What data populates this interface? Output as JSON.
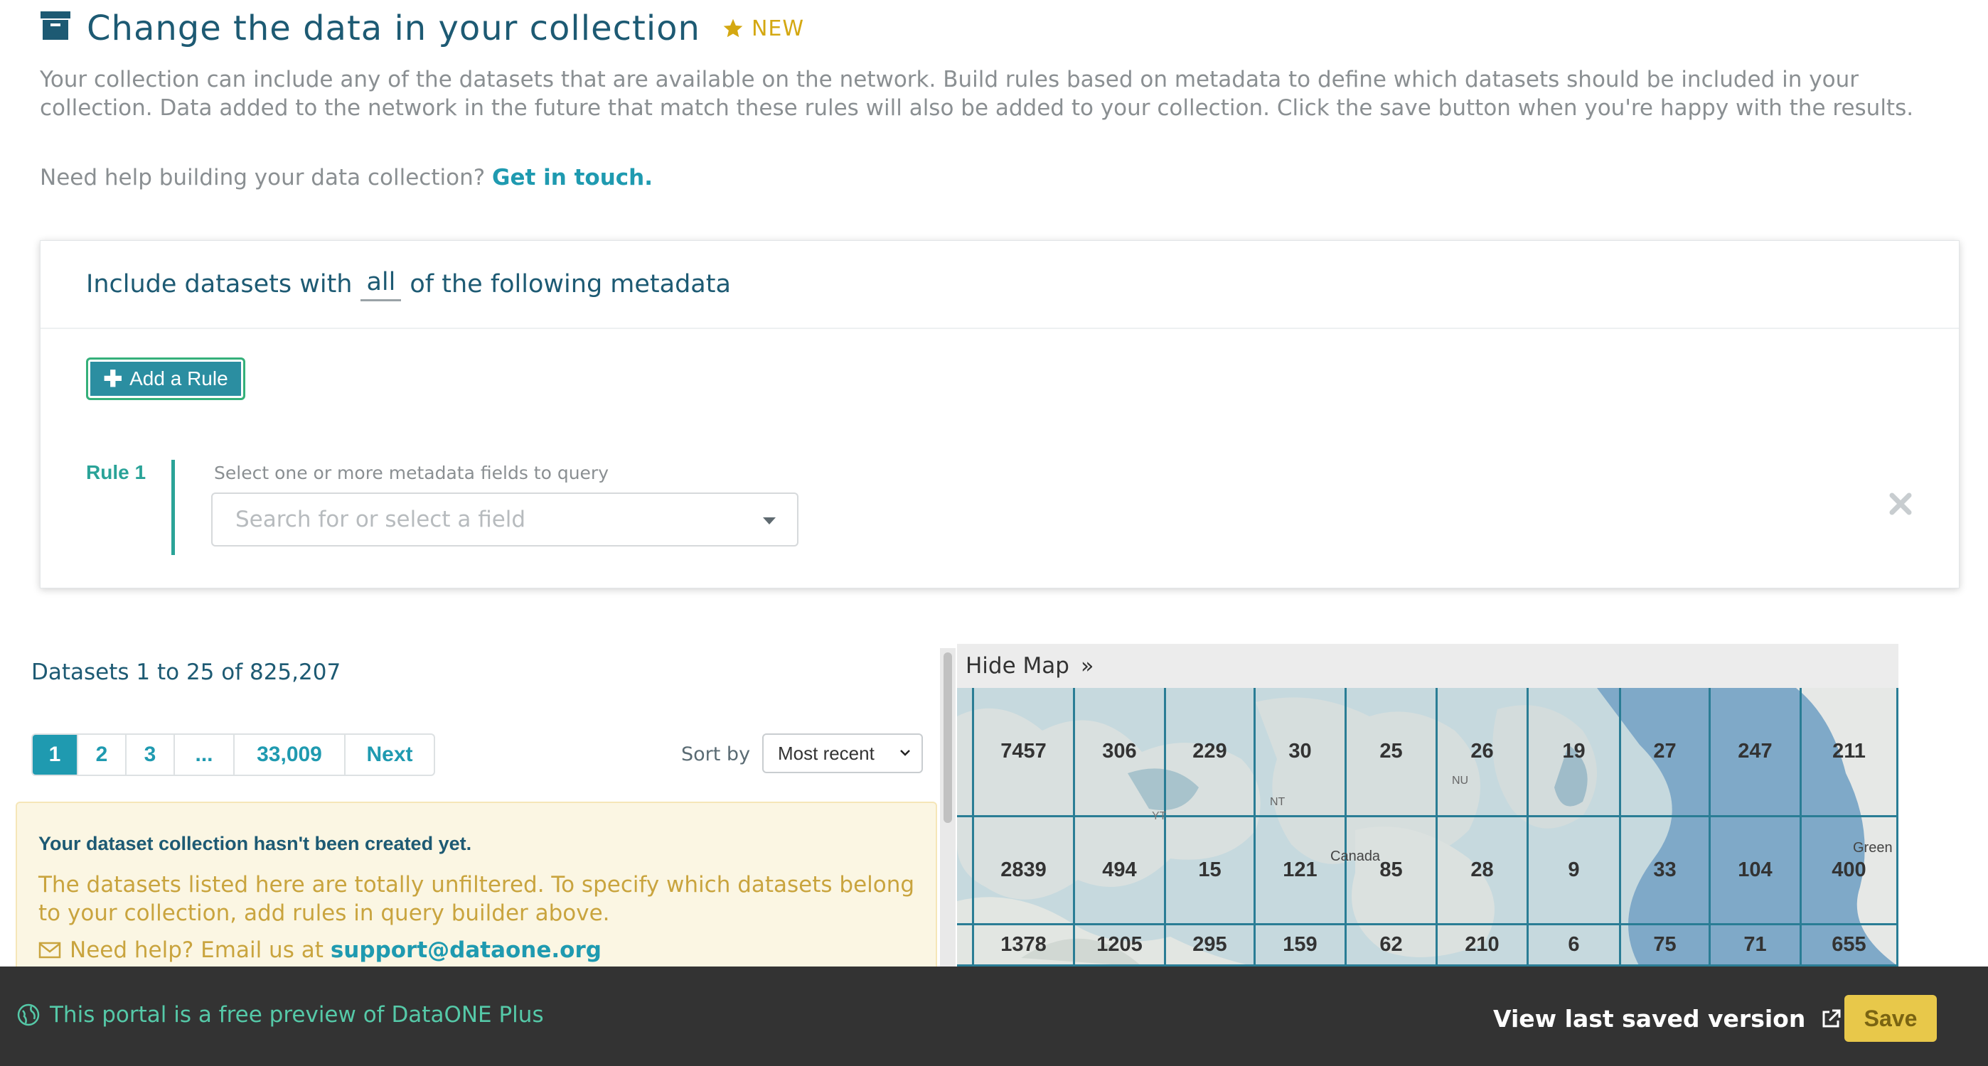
{
  "header": {
    "icon": "archive-box-icon",
    "title": "Change the data in your collection",
    "badge_icon": "star-icon",
    "badge_label": "NEW",
    "accent_color": "#1d5a73",
    "badge_color": "#d4a812"
  },
  "intro": {
    "text": "Your collection can include any of the datasets that are available on the network. Build rules based on metadata to define which datasets should be included in your collection. Data added to the network in the future that match these rules will also be added to your collection. Click the save button when you're happy with the results.",
    "help_prefix": "Need help building your data collection?",
    "help_link": "Get in touch."
  },
  "query_builder": {
    "header_prefix": "Include datasets with",
    "operator": "all",
    "header_suffix": "of the following metadata",
    "add_rule_label": "Add a Rule",
    "rule": {
      "label": "Rule 1",
      "hint": "Select one or more metadata fields to query",
      "placeholder": "Search for or select a field"
    }
  },
  "results": {
    "count_text": "Datasets 1 to 25 of 825,207",
    "pages": [
      "1",
      "2",
      "3",
      "...",
      "33,009",
      "Next"
    ],
    "active_page": "1",
    "sort_label": "Sort by",
    "sort_value": "Most recent"
  },
  "alert": {
    "title": "Your dataset collection hasn't been created yet.",
    "body": "The datasets listed here are totally unfiltered. To specify which datasets belong to your collection, add rules in query builder above.",
    "help_prefix": "Need help? Email us at",
    "help_email": "support@dataone.org"
  },
  "map": {
    "toggle_label": "Hide Map",
    "place_labels": [
      "Canada",
      "NU",
      "NT",
      "YT",
      "Green"
    ],
    "rows": [
      [
        "",
        "7457",
        "306",
        "229",
        "30",
        "25",
        "26",
        "19",
        "27",
        "247",
        "211"
      ],
      [
        "",
        "2839",
        "494",
        "15",
        "121",
        "85",
        "28",
        "9",
        "33",
        "104",
        "400"
      ],
      [
        "",
        "1378",
        "1205",
        "295",
        "159",
        "62",
        "210",
        "6",
        "75",
        "71",
        "655"
      ]
    ]
  },
  "footer": {
    "preview_text": "This portal is a free preview of DataONE Plus",
    "view_link": "View last saved version",
    "save_label": "Save",
    "preview_color": "#55c9a8",
    "save_color": "#e8c84a"
  }
}
